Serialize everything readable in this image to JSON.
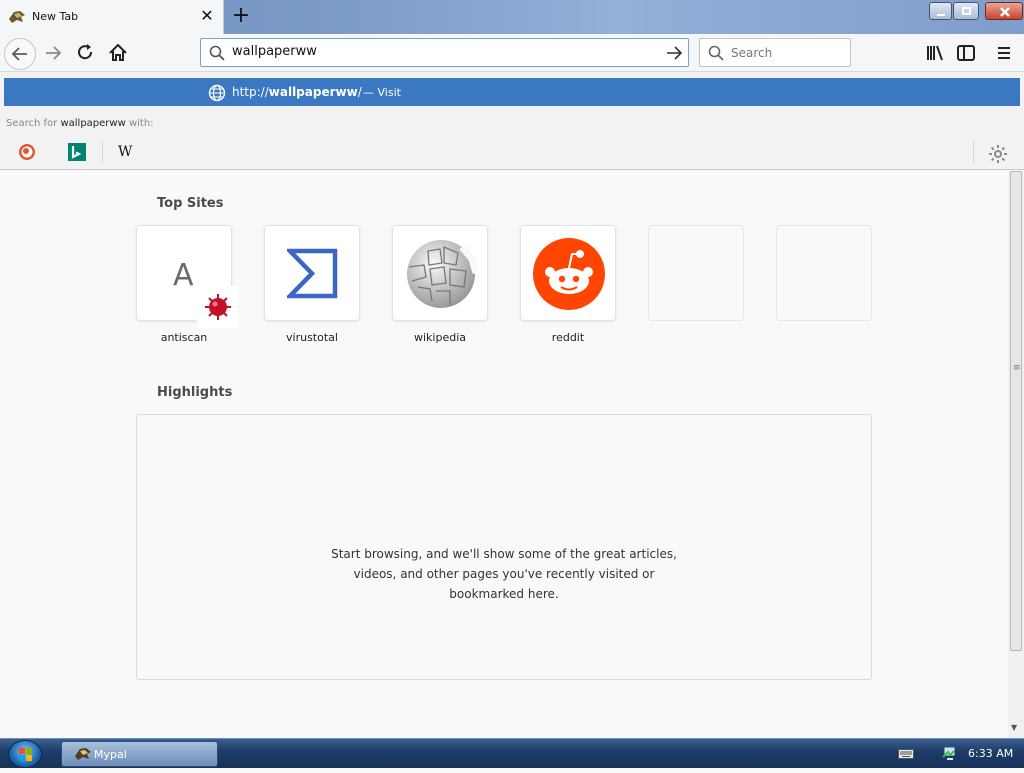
{
  "tab": {
    "title": "New Tab",
    "close_glyph": "✕",
    "new_tab_glyph": "+"
  },
  "window_controls": [
    "minimize-icon",
    "maximize-icon",
    "close-icon"
  ],
  "nav": {
    "url_value": "wallpaperww",
    "search_placeholder": "Search",
    "icons": [
      "back-arrow-icon",
      "forward-arrow-icon",
      "reload-icon",
      "home-icon",
      "go-arrow-icon",
      "library-icon",
      "sidebar-icon",
      "hamburger-menu-icon"
    ]
  },
  "suggestion": {
    "url_prefix": "http://",
    "url_bold": "wallpaperww",
    "url_suffix": "/",
    "action": "— Visit",
    "search_for_prefix": "Search for ",
    "search_for_query": "wallpaperww",
    "search_for_suffix": " with:",
    "engines": [
      "duckduckgo-icon",
      "bing-icon",
      "wikipedia-icon"
    ],
    "wikipedia_glyph": "W"
  },
  "content": {
    "top_sites_title": "Top Sites",
    "top_sites": [
      {
        "label": "antiscan",
        "letter": "A"
      },
      {
        "label": "virustotal"
      },
      {
        "label": "wikipedia"
      },
      {
        "label": "reddit"
      },
      {
        "label": ""
      },
      {
        "label": ""
      }
    ],
    "highlights_title": "Highlights",
    "highlights_message": "Start browsing, and we'll show some of the great articles, videos, and other pages you've recently visited or bookmarked here."
  },
  "taskbar": {
    "app_label": "Mypal",
    "clock": "6:33 AM"
  },
  "colors": {
    "accent": "#3a78c2",
    "reddit": "#ff4500",
    "virustotal": "#3b66c4"
  }
}
